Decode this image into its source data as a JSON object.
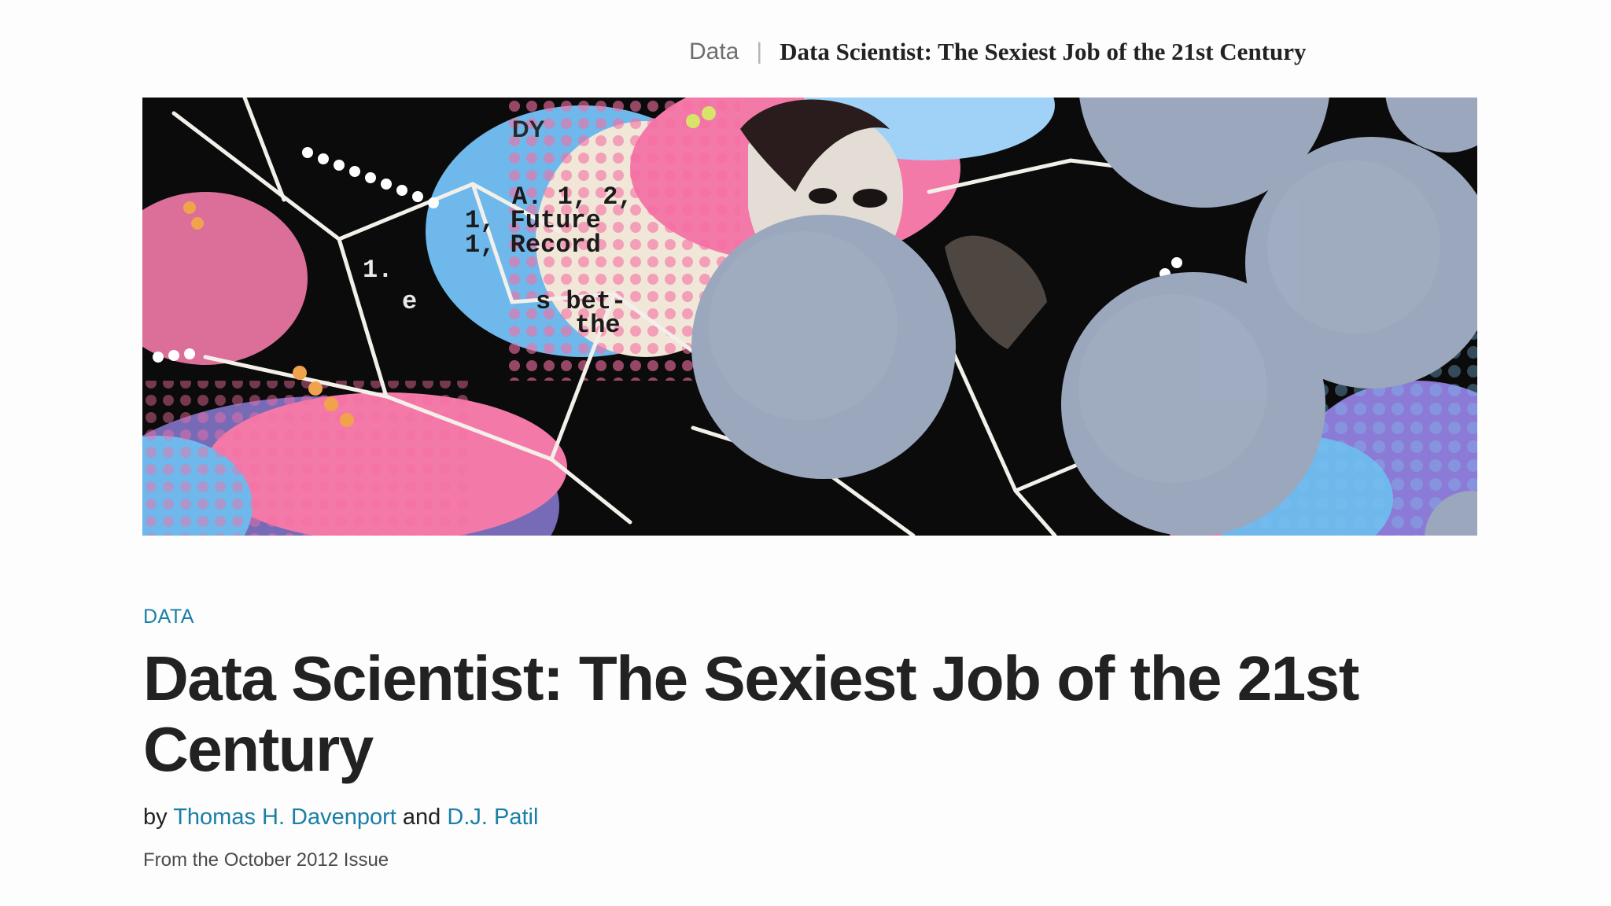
{
  "breadcrumb": {
    "section": "Data",
    "separator": "|",
    "title": "Data Scientist: The Sexiest Job of the 21st Century"
  },
  "hero": {
    "collage_text": {
      "top_word": "DY",
      "line1": "A. 1, 2,",
      "line2": "1, Future",
      "line3": "1, Record",
      "line4": "s bet-",
      "line5": "the",
      "left1": "1.",
      "left2": "e"
    }
  },
  "article": {
    "kicker": "DATA",
    "headline": "Data Scientist: The Sexiest Job of the 21st Century",
    "byline_prefix": "by",
    "author1": "Thomas H. Davenport",
    "byline_and": "and",
    "author2": "D.J. Patil",
    "issue": "From the October 2012 Issue"
  },
  "colors": {
    "link": "#1a7fa6",
    "headline": "#222222",
    "pink": "#f06fa0",
    "blue": "#6eb8ec",
    "grey_dot": "#9aa7bd"
  }
}
